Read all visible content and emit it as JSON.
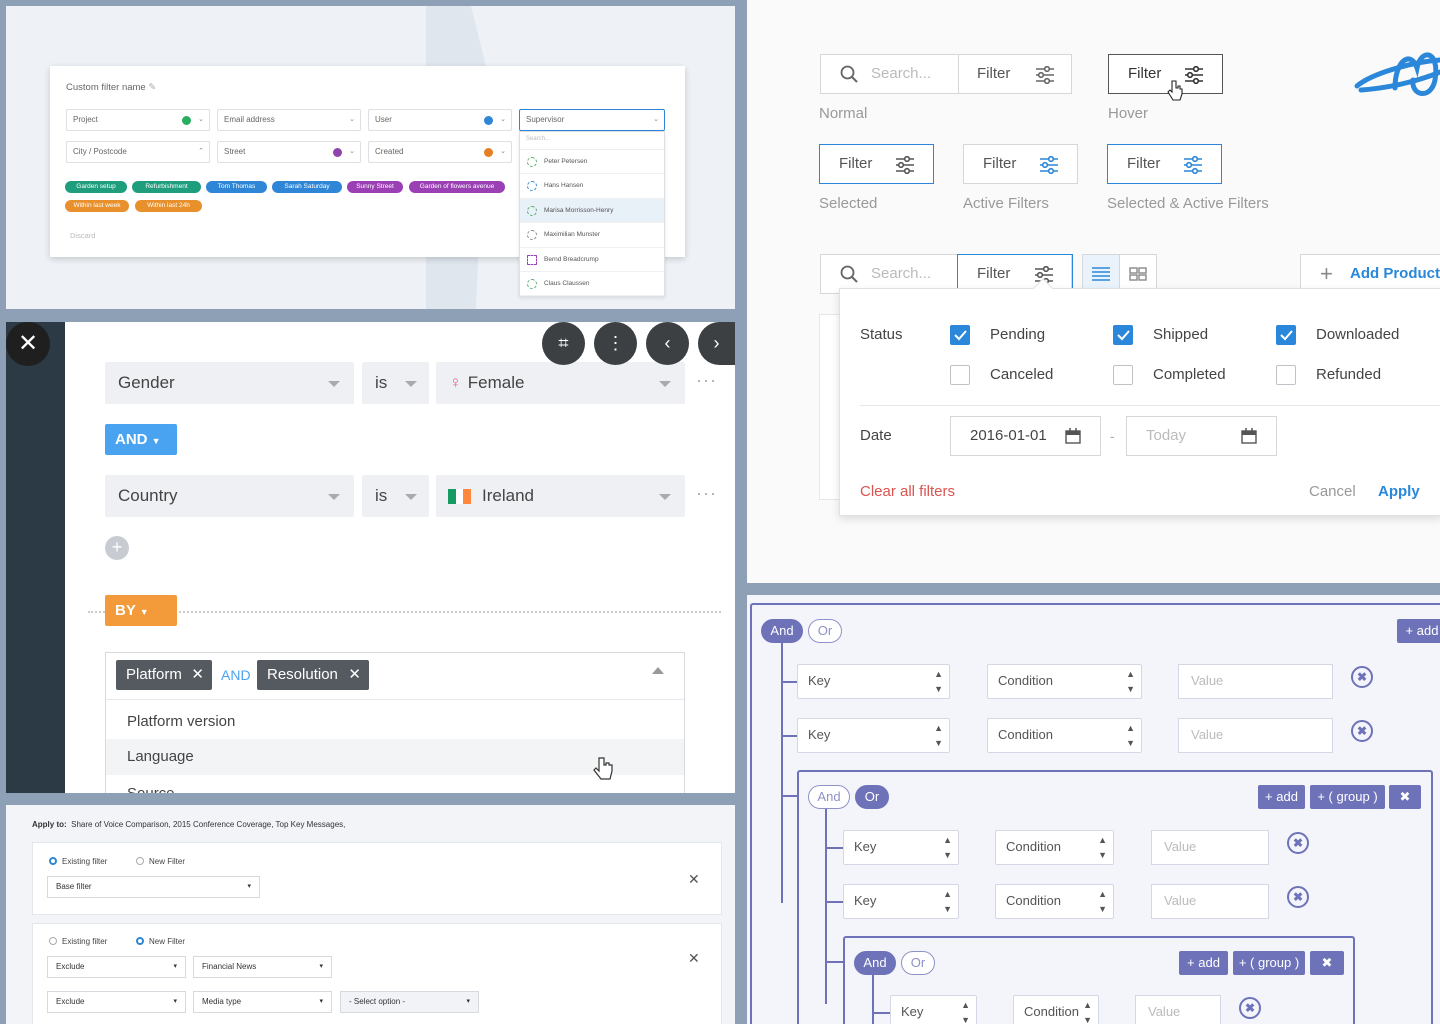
{
  "p1": {
    "title": "Custom filter name",
    "edit_icon": "pencil-icon",
    "fields": [
      "Project",
      "Email address",
      "User",
      "Supervisor",
      "City / Postcode",
      "Street",
      "Created"
    ],
    "search_placeholder": "Search...",
    "people": [
      "Peter Petersen",
      "Hans Hansen",
      "Marisa Morrisson-Henry",
      "Maximilian Munster",
      "Bernd Breadcrump",
      "Claus Claussen"
    ],
    "chips": [
      "Garden setup",
      "Refurbishment",
      "Tom Thomas",
      "Sarah Saturday",
      "Sunny Street",
      "Garden of flowers avenue",
      "Within last week",
      "Within last 24h"
    ],
    "discard": "Discard"
  },
  "p2": {
    "row1": {
      "field": "Gender",
      "op": "is",
      "value": "Female"
    },
    "and_label": "AND",
    "row2": {
      "field": "Country",
      "op": "is",
      "value": "Ireland"
    },
    "by_label": "BY",
    "tags": [
      "Platform",
      "Resolution"
    ],
    "tag_join": "AND",
    "options": [
      "Platform version",
      "Language",
      "Source"
    ],
    "close_icon": "close-icon"
  },
  "p3": {
    "apply_label": "Apply to:",
    "apply_value": "Share of Voice Comparison, 2015 Conference Coverage, Top Key Messages,",
    "existing": "Existing filter",
    "new": "New Filter",
    "base_filter": "Base filter",
    "exclude": "Exclude",
    "financial_news": "Financial News",
    "media_type": "Media type",
    "select_option": "- Select option -"
  },
  "p4": {
    "search_placeholder": "Search...",
    "filter_label": "Filter",
    "states": [
      "Normal",
      "Hover",
      "Selected",
      "Active Filters",
      "Selected & Active Filters"
    ],
    "add_product": "Add Product",
    "status_label": "Status",
    "statuses": [
      {
        "label": "Pending",
        "checked": true
      },
      {
        "label": "Shipped",
        "checked": true
      },
      {
        "label": "Downloaded",
        "checked": true
      },
      {
        "label": "Canceled",
        "checked": false
      },
      {
        "label": "Completed",
        "checked": false
      },
      {
        "label": "Refunded",
        "checked": false
      }
    ],
    "date_label": "Date",
    "date_from": "2016-01-01",
    "date_sep": "-",
    "date_to": "Today",
    "clear": "Clear all filters",
    "cancel": "Cancel",
    "apply": "Apply",
    "accent": "#2a87d9",
    "danger": "#d9534f"
  },
  "p5": {
    "and": "And",
    "or": "Or",
    "add": "+ add",
    "group": "+ ( group )",
    "remove": "✖",
    "key": "Key",
    "condition": "Condition",
    "value": "Value",
    "accent": "#6e72b8"
  }
}
